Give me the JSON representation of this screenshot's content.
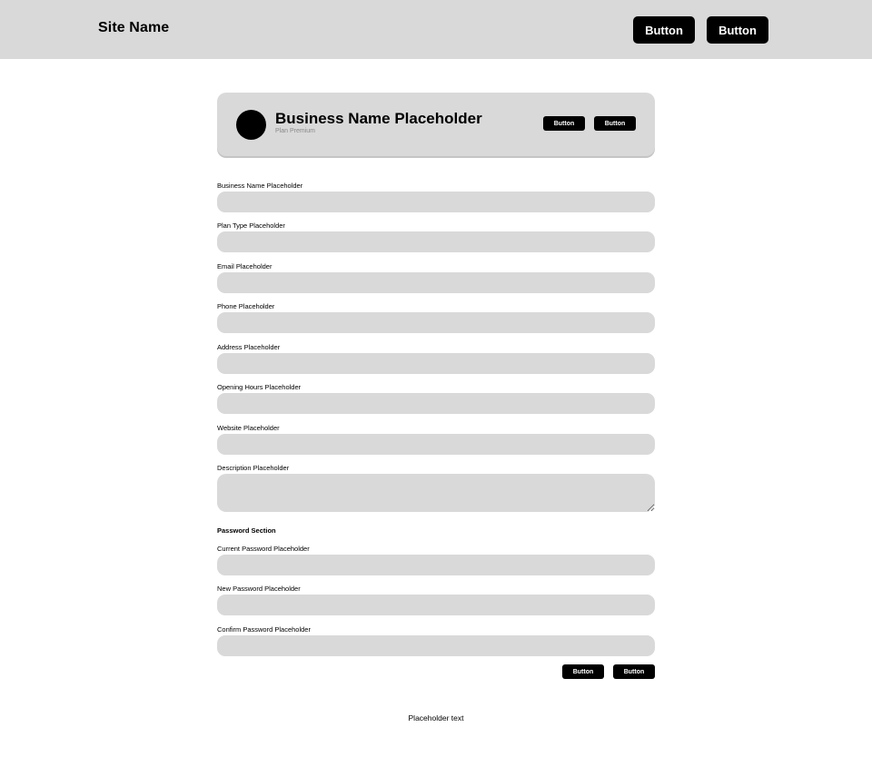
{
  "header": {
    "site_name": "Site Name",
    "buttons": [
      "Button",
      "Button"
    ]
  },
  "profile": {
    "business_name": "Business Name Placeholder",
    "plan": "Plan Premium",
    "buttons": [
      "Button",
      "Button"
    ]
  },
  "form": {
    "fields": [
      {
        "label": "Business Name Placeholder",
        "value": ""
      },
      {
        "label": "Plan Type Placeholder",
        "value": ""
      },
      {
        "label": "Email Placeholder",
        "value": ""
      },
      {
        "label": "Phone Placeholder",
        "value": ""
      },
      {
        "label": "Address Placeholder",
        "value": ""
      },
      {
        "label": "Opening Hours Placeholder",
        "value": ""
      },
      {
        "label": "Website Placeholder",
        "value": ""
      },
      {
        "label": "Description Placeholder",
        "value": ""
      }
    ],
    "password_section": {
      "title": "Password Section",
      "fields": [
        {
          "label": "Current Password Placeholder",
          "value": ""
        },
        {
          "label": "New Password Placeholder",
          "value": ""
        },
        {
          "label": "Confirm Password Placeholder",
          "value": ""
        }
      ]
    },
    "buttons": [
      "Button",
      "Button"
    ]
  },
  "footer": {
    "text": "Placeholder text"
  },
  "colors": {
    "panel_gray": "#d9d9d9",
    "primary_black": "#000000",
    "muted_text": "#8a8a8a"
  }
}
